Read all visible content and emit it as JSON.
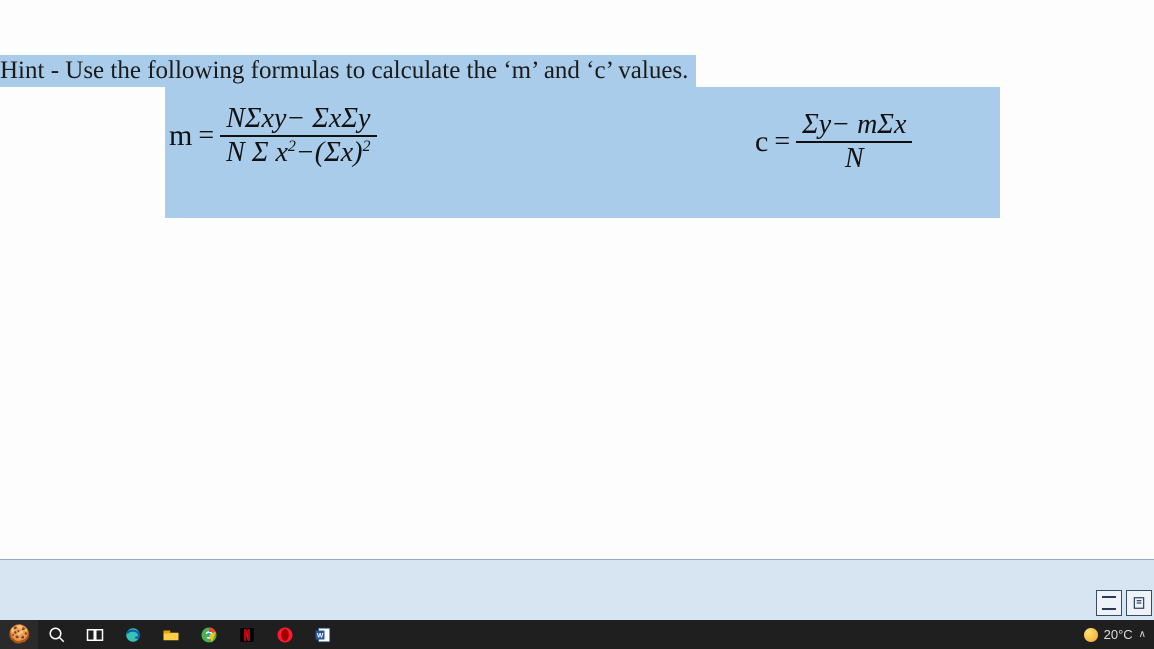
{
  "hint": {
    "text": "Hint - Use the following formulas to calculate the ‘m’ and ‘c’ values."
  },
  "formulas": {
    "m": {
      "lhs": "m",
      "eq": "=",
      "num": "NΣxy− ΣxΣy",
      "den_prefix": "N Σ x",
      "den_exp1": "2",
      "den_mid": "−(Σx)",
      "den_exp2": "2"
    },
    "c": {
      "lhs": "c",
      "eq": "=",
      "num": "Σy− mΣx",
      "den": "N"
    }
  },
  "taskbar": {
    "emoji": "🍪",
    "temp": "20°C",
    "caret": "∧"
  },
  "icons": {
    "search": "search-icon",
    "taskview": "taskview-icon",
    "edge": "edge-icon",
    "explorer": "explorer-icon",
    "chrome": "chrome-icon",
    "netflix": "netflix-icon",
    "opera": "opera-icon",
    "word": "word-icon"
  }
}
